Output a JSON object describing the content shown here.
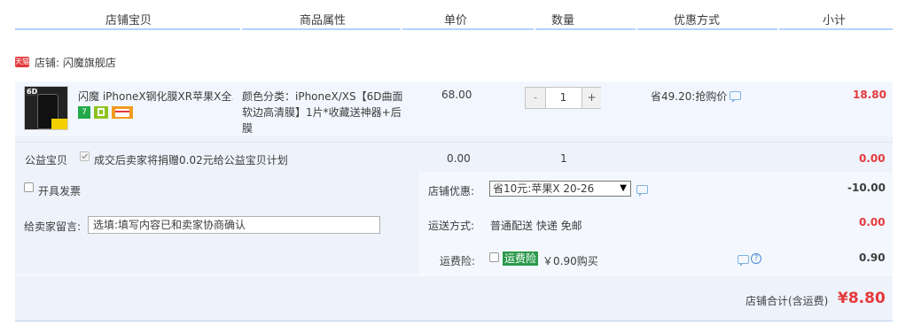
{
  "header": {
    "col_item": "店铺宝贝",
    "col_props": "商品属性",
    "col_price": "单价",
    "col_qty": "数量",
    "col_discount": "优惠方式",
    "col_subtotal": "小计"
  },
  "shop": {
    "badge": "天猫",
    "label": "店铺: 闪魔旗舰店"
  },
  "item": {
    "title": "闪魔 iPhoneX钢化膜XR苹果X全…",
    "props": "颜色分类：iPhoneX/XS【6D曲面软边高清膜】1片*收藏送神器+后膜",
    "price": "68.00",
    "quantity": "1",
    "minus": "-",
    "plus": "+",
    "promo": "省49.20:抢购价",
    "subtotal": "18.80",
    "badge_7": "7",
    "thumb_tag": "6D"
  },
  "charity": {
    "label": "公益宝贝",
    "text": "成交后卖家将捐赠0.02元给公益宝贝计划",
    "price": "0.00",
    "qty": "1",
    "subtotal": "0.00"
  },
  "options": {
    "invoice_label": "开具发票",
    "message_label": "给卖家留言:",
    "message_placeholder": "选填:填写内容已和卖家协商确认",
    "shop_discount_label": "店铺优惠:",
    "shop_discount_value": "省10元:苹果X 20-26",
    "shop_discount_amount": "-10.00",
    "shipping_label": "运送方式:",
    "shipping_value": "普通配送 快递 免邮",
    "shipping_amount": "0.00",
    "insurance_label": "运费险:",
    "insurance_tag": "运费险",
    "insurance_text": "￥0.90购买",
    "insurance_amount": "0.90",
    "help": "?"
  },
  "footer": {
    "total_label": "店铺合计(含运费)",
    "total_value": "¥8.80"
  },
  "colors": {
    "accent_red": "#e4393c",
    "header_line": "#b2d1ff",
    "insurance_green": "#2b9a4b"
  }
}
